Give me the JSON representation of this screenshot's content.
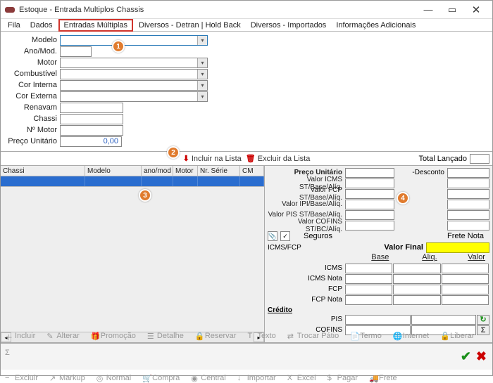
{
  "window": {
    "title": "Estoque - Entrada Multiplos Chassis",
    "min": "—",
    "restore": "▭",
    "close": "✕"
  },
  "menu": {
    "items": [
      "Fila",
      "Dados",
      "Entradas Múltiplas",
      "Diversos - Detran | Hold Back",
      "Diversos - Importados",
      "Informações Adicionais"
    ],
    "active_index": 2
  },
  "form": {
    "labels": {
      "modelo": "Modelo",
      "anomod": "Ano/Mod.",
      "motor": "Motor",
      "combustivel": "Combustível",
      "corinterna": "Cor Interna",
      "corexterna": "Cor Externa",
      "renavam": "Renavam",
      "chassi": "Chassi",
      "nmotor": "Nº Motor",
      "precounit": "Preço Unitário"
    },
    "values": {
      "modelo": "",
      "anomod": "",
      "motor": "",
      "combustivel": "",
      "corinterna": "",
      "corexterna": "",
      "renavam": "",
      "chassi": "",
      "nmotor": "",
      "precounit": "0,00"
    }
  },
  "mid": {
    "incluir": "Incluir na Lista",
    "excluir": "Excluir da Lista",
    "total_label": "Total Lançado",
    "total_value": ""
  },
  "grid": {
    "columns": [
      "Chassi",
      "Modelo",
      "ano/mod",
      "Motor",
      "Nr. Série",
      "CM"
    ]
  },
  "right": {
    "rows": [
      {
        "label": "Preço Unitário",
        "label2": "-Desconto"
      },
      {
        "label": "Valor ICMS ST/Base/Alíq.",
        "label2": ""
      },
      {
        "label": "Valor FCP ST/Base/Alíq.",
        "label2": ""
      },
      {
        "label": "Valor IPI/Base/Alíq.",
        "label2": ""
      },
      {
        "label": "Valor PIS ST/Base/Alíq.",
        "label2": ""
      },
      {
        "label": "Valor COFINS ST/BC/Alíq.",
        "label2": ""
      }
    ],
    "seguros_label": "Seguros",
    "frete_label": "Frete Nota",
    "valorfinal_label": "Valor Final",
    "icmsfcp_label": "ICMS/FCP",
    "tax_headers": [
      "Base",
      "Aliq.",
      "Valor"
    ],
    "tax_rows": [
      "ICMS",
      "ICMS Nota",
      "FCP",
      "FCP Nota"
    ],
    "credito_label": "Crédito",
    "credito_rows": [
      "PIS",
      "COFINS"
    ]
  },
  "toolbar": {
    "items": [
      "Incluir",
      "Alterar",
      "Promoção",
      "Detalhe",
      "Reservar",
      "Texto",
      "Trocar Pátio",
      "Termo",
      "Internet",
      "Liberar",
      "Σ",
      "Excluir",
      "Markup",
      "Normal",
      "Compra",
      "Central",
      "Importar",
      "Excel",
      "Pagar",
      "Frete"
    ]
  },
  "badges": {
    "1": "1",
    "2": "2",
    "3": "3",
    "4": "4"
  }
}
